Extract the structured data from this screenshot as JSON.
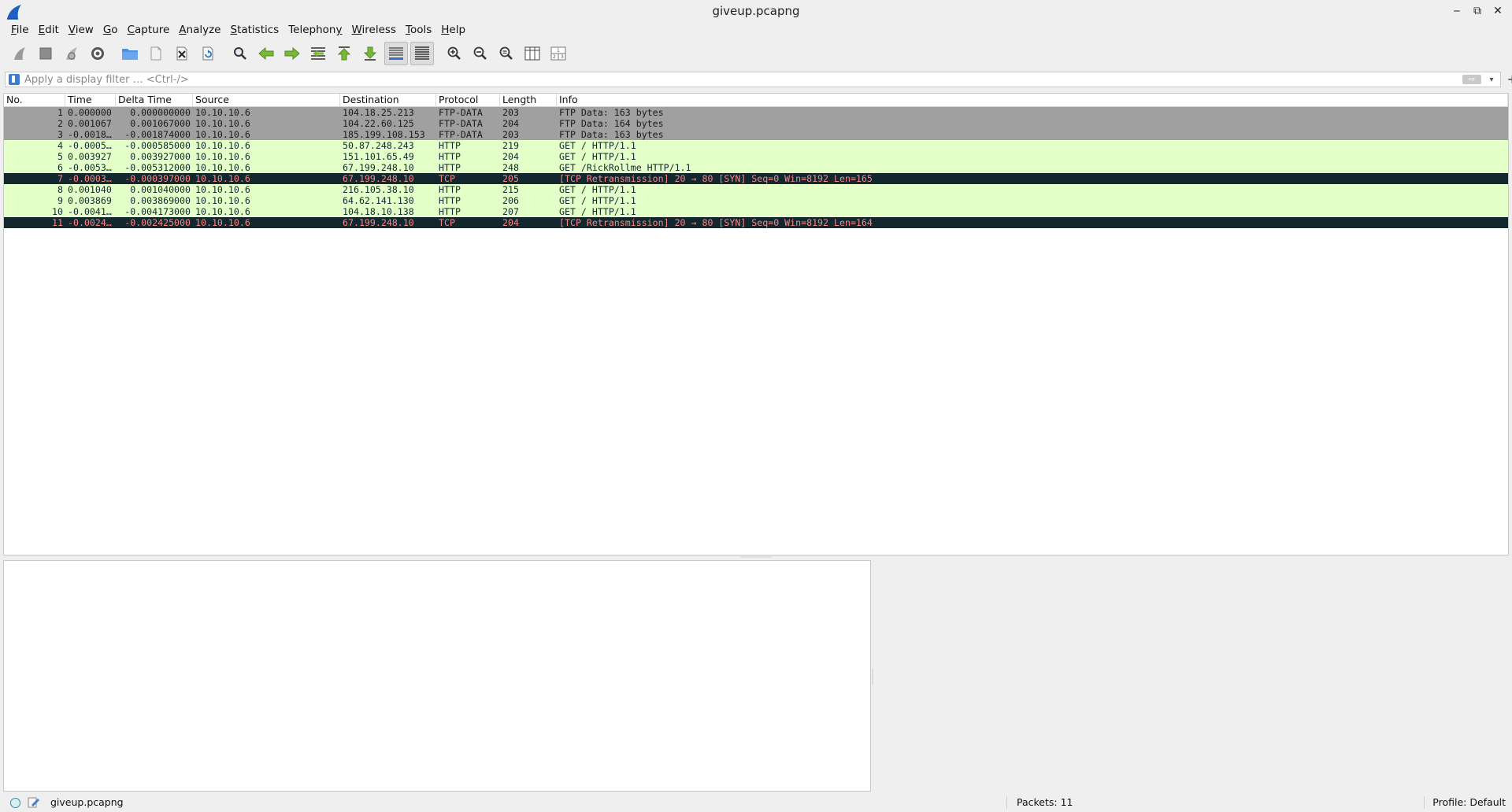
{
  "window": {
    "title": "giveup.pcapng",
    "minimize_glyph": "‒",
    "maximize_glyph": "⧉",
    "close_glyph": "✕"
  },
  "menu": [
    {
      "label": "File",
      "accel": "F",
      "rest": "ile"
    },
    {
      "label": "Edit",
      "accel": "E",
      "rest": "dit"
    },
    {
      "label": "View",
      "accel": "V",
      "rest": "iew"
    },
    {
      "label": "Go",
      "accel": "G",
      "rest": "o"
    },
    {
      "label": "Capture",
      "accel": "C",
      "rest": "apture"
    },
    {
      "label": "Analyze",
      "accel": "A",
      "rest": "nalyze"
    },
    {
      "label": "Statistics",
      "accel": "S",
      "rest": "tatistics"
    },
    {
      "label": "Telephony",
      "accel": "y",
      "pre": "Telephon",
      "rest": ""
    },
    {
      "label": "Wireless",
      "accel": "W",
      "rest": "ireless"
    },
    {
      "label": "Tools",
      "accel": "T",
      "rest": "ools"
    },
    {
      "label": "Help",
      "accel": "H",
      "rest": "elp"
    }
  ],
  "toolbar": {
    "icons": [
      "start-capture-icon",
      "stop-capture-icon",
      "restart-capture-icon",
      "capture-options-icon",
      "open-file-icon",
      "save-file-icon",
      "close-file-icon",
      "reload-file-icon",
      "find-packet-icon",
      "go-back-icon",
      "go-forward-icon",
      "go-to-packet-icon",
      "go-first-packet-icon",
      "go-last-packet-icon",
      "autoscroll-icon",
      "colorize-icon",
      "zoom-in-icon",
      "zoom-out-icon",
      "zoom-normal-icon",
      "resize-columns-icon",
      "layout-icon"
    ]
  },
  "filter": {
    "placeholder": "Apply a display filter … <Ctrl-/>",
    "apply_glyph": "⇨",
    "dropdown_glyph": "▾",
    "add_glyph": "+"
  },
  "packet_list": {
    "columns": [
      "No.",
      "Time",
      "Delta Time",
      "Source",
      "Destination",
      "Protocol",
      "Length",
      "Info"
    ],
    "colors": {
      "ftp_bg": "#a0a0a0",
      "ftp_fg": "#1a1a1a",
      "http_bg": "#e4ffc7",
      "http_fg": "#12272e",
      "bad_bg": "#12272e",
      "bad_fg": "#f78787"
    },
    "rows": [
      {
        "no": "1",
        "time": "0.000000",
        "delta": "0.000000000",
        "src": "10.10.10.6",
        "dst": "104.18.25.213",
        "proto": "FTP-DATA",
        "len": "203",
        "info": "FTP Data: 163 bytes",
        "style": "ftp"
      },
      {
        "no": "2",
        "time": "0.001067",
        "delta": "0.001067000",
        "src": "10.10.10.6",
        "dst": "104.22.60.125",
        "proto": "FTP-DATA",
        "len": "204",
        "info": "FTP Data: 164 bytes",
        "style": "ftp"
      },
      {
        "no": "3",
        "time": "-0.0018…",
        "delta": "-0.001874000",
        "src": "10.10.10.6",
        "dst": "185.199.108.153",
        "proto": "FTP-DATA",
        "len": "203",
        "info": "FTP Data: 163 bytes",
        "style": "ftp"
      },
      {
        "no": "4",
        "time": "-0.0005…",
        "delta": "-0.000585000",
        "src": "10.10.10.6",
        "dst": "50.87.248.243",
        "proto": "HTTP",
        "len": "219",
        "info": "GET / HTTP/1.1",
        "style": "http"
      },
      {
        "no": "5",
        "time": "0.003927",
        "delta": "0.003927000",
        "src": "10.10.10.6",
        "dst": "151.101.65.49",
        "proto": "HTTP",
        "len": "204",
        "info": "GET / HTTP/1.1",
        "style": "http"
      },
      {
        "no": "6",
        "time": "-0.0053…",
        "delta": "-0.005312000",
        "src": "10.10.10.6",
        "dst": "67.199.248.10",
        "proto": "HTTP",
        "len": "248",
        "info": "GET /RickRollme HTTP/1.1",
        "style": "http"
      },
      {
        "no": "7",
        "time": "-0.0003…",
        "delta": "-0.000397000",
        "src": "10.10.10.6",
        "dst": "67.199.248.10",
        "proto": "TCP",
        "len": "205",
        "info": "[TCP Retransmission] 20 → 80 [SYN] Seq=0 Win=8192 Len=165",
        "style": "bad"
      },
      {
        "no": "8",
        "time": "0.001040",
        "delta": "0.001040000",
        "src": "10.10.10.6",
        "dst": "216.105.38.10",
        "proto": "HTTP",
        "len": "215",
        "info": "GET / HTTP/1.1",
        "style": "http"
      },
      {
        "no": "9",
        "time": "0.003869",
        "delta": "0.003869000",
        "src": "10.10.10.6",
        "dst": "64.62.141.130",
        "proto": "HTTP",
        "len": "206",
        "info": "GET / HTTP/1.1",
        "style": "http"
      },
      {
        "no": "10",
        "time": "-0.0041…",
        "delta": "-0.004173000",
        "src": "10.10.10.6",
        "dst": "104.18.10.138",
        "proto": "HTTP",
        "len": "207",
        "info": "GET / HTTP/1.1",
        "style": "http"
      },
      {
        "no": "11",
        "time": "-0.0024…",
        "delta": "-0.002425000",
        "src": "10.10.10.6",
        "dst": "67.199.248.10",
        "proto": "TCP",
        "len": "204",
        "info": "[TCP Retransmission] 20 → 80 [SYN] Seq=0 Win=8192 Len=164",
        "style": "bad"
      }
    ]
  },
  "status": {
    "file": "giveup.pcapng",
    "packets": "Packets: 11",
    "profile": "Profile: Default"
  }
}
